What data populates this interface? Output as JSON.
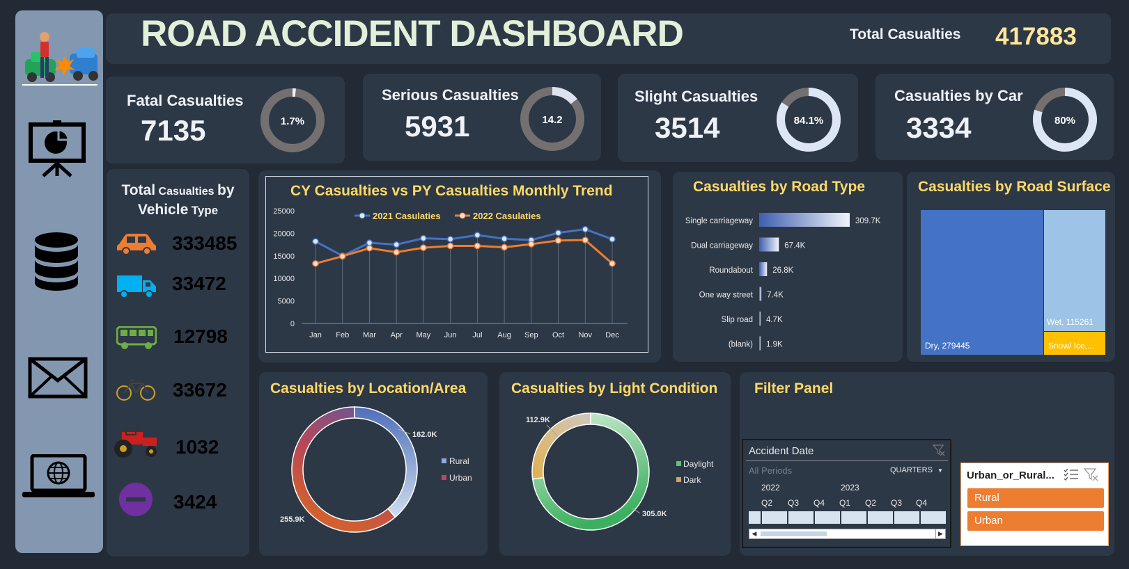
{
  "header": {
    "title": "ROAD ACCIDENT DASHBOARD",
    "total_label": "Total Casualties",
    "total_value": "417883"
  },
  "kpis": [
    {
      "label": "Fatal Casualties",
      "value": "7135",
      "pct_label": "1.7%",
      "fraction": 0.017
    },
    {
      "label": "Serious  Casualties",
      "value": "5931",
      "pct_label": "14.2",
      "fraction": 0.142
    },
    {
      "label": "Slight Casualties",
      "value": "3514",
      "pct_label": "84.1%",
      "fraction": 0.841
    },
    {
      "label": "Casualties by Car",
      "value": "3334",
      "pct_label": "80%",
      "fraction": 0.8
    }
  ],
  "vehicle": {
    "title_a": "Total",
    "title_b": "Casualties",
    "title_c": "by",
    "title_d": "Vehicle",
    "title_e": "Type",
    "items": [
      {
        "icon": "car-icon",
        "value": "333485",
        "color": "#ed7d31"
      },
      {
        "icon": "truck-icon",
        "value": "33472",
        "color": "#00b0f0"
      },
      {
        "icon": "bus-icon",
        "value": "12798",
        "color": "#70ad47"
      },
      {
        "icon": "bicycle-icon",
        "value": "33672",
        "color": "#ffc000"
      },
      {
        "icon": "tractor-icon",
        "value": "1032",
        "color": "#ff0000"
      },
      {
        "icon": "minus-circle-icon",
        "value": "3424",
        "color": "#7030a0"
      }
    ]
  },
  "trend": {
    "title": "CY Casualties vs PY Casualties Monthly Trend",
    "chart_data": {
      "type": "line",
      "categories": [
        "Jan",
        "Feb",
        "Mar",
        "Apr",
        "May",
        "Jun",
        "Jul",
        "Aug",
        "Sep",
        "Oct",
        "Nov",
        "Dec"
      ],
      "series": [
        {
          "name": "2021 Casulaties",
          "color": "#4472c4",
          "values": [
            18200,
            15000,
            17900,
            17500,
            18900,
            18700,
            19600,
            18800,
            18500,
            20100,
            20900,
            18700
          ]
        },
        {
          "name": "2022 Casulaties",
          "color": "#ed7d31",
          "values": [
            13300,
            14900,
            16700,
            15800,
            16800,
            17200,
            17200,
            16900,
            17600,
            18400,
            18500,
            13300
          ]
        }
      ],
      "yticks": [
        "25000",
        "20000",
        "15000",
        "10000",
        "5000",
        "0"
      ],
      "ylim": [
        0,
        25000
      ]
    }
  },
  "road_type": {
    "title": "Casualties by Road Type",
    "chart_data": {
      "type": "bar",
      "categories": [
        "Single carriageway",
        "Dual carriageway",
        "Roundabout",
        "One way street",
        "Slip road",
        "(blank)"
      ],
      "values": [
        309.7,
        67.4,
        26.8,
        7.4,
        4.7,
        1.9
      ],
      "labels": [
        "309.7K",
        "67.4K",
        "26.8K",
        "7.4K",
        "4.7K",
        "1.9K"
      ]
    }
  },
  "road_surface": {
    "title": "Casualties by Road Surface",
    "chart_data": {
      "type": "treemap",
      "items": [
        {
          "label": "Dry, 279445",
          "value": 279445,
          "color": "#4472c4"
        },
        {
          "label": "Wet, 115261",
          "value": 115261,
          "color": "#9dc3e6"
        },
        {
          "label": "Snow/ Ice,...",
          "value": 23177,
          "color": "#ffc000"
        }
      ]
    }
  },
  "location": {
    "title": "Casualties by Location/Area",
    "chart_data": {
      "type": "pie",
      "items": [
        {
          "name": "Rural",
          "value": 162.0,
          "label": "162.0K",
          "color": "#8faadc"
        },
        {
          "name": "Urban",
          "value": 255.9,
          "label": "255.9K",
          "color": "#b94c5e"
        }
      ]
    }
  },
  "light": {
    "title": "Casualties by Light Condition",
    "chart_data": {
      "type": "pie",
      "items": [
        {
          "name": "Daylight",
          "value": 305.0,
          "label": "305.0K",
          "color": "#5cc47a"
        },
        {
          "name": "Dark",
          "value": 112.9,
          "label": "112.9K",
          "color": "#c9a66b"
        }
      ]
    }
  },
  "filter": {
    "title": "Filter Panel",
    "timeline": {
      "header": "Accident Date",
      "all_periods": "All Periods",
      "level": "QUARTERS",
      "years": [
        "2022",
        "2023"
      ],
      "quarters": [
        "Q2",
        "Q3",
        "Q4",
        "Q1",
        "Q2",
        "Q3",
        "Q4"
      ]
    },
    "slicer": {
      "header": "Urban_or_Rural...",
      "items": [
        "Rural",
        "Urban"
      ]
    }
  }
}
